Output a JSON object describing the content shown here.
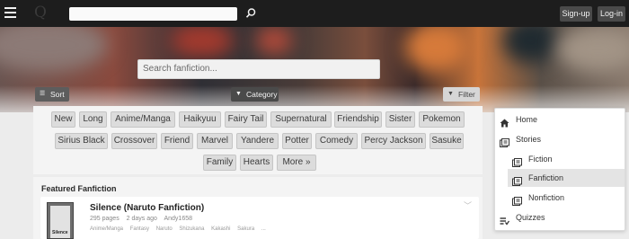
{
  "topbar": {
    "logo": "Q",
    "search_placeholder": "",
    "signup_label": "Sign-up",
    "login_label": "Log-in"
  },
  "hero": {
    "search_placeholder": "Search fanfiction...",
    "sort_label": "Sort",
    "category_label": "Category",
    "filter_label": "Filter"
  },
  "tags": [
    "New",
    "Long",
    "Anime/Manga",
    "Haikyuu",
    "Fairy Tail",
    "Supernatural",
    "Friendship",
    "Sister",
    "Pokemon",
    "Sirius Black",
    "Crossover",
    "Friend",
    "Marvel",
    "Yandere",
    "Potter",
    "Comedy",
    "Percy Jackson",
    "Sasuke",
    "Family",
    "Hearts",
    "More »"
  ],
  "featured": {
    "heading": "Featured Fanfiction",
    "story": {
      "title": "Silence (Naruto Fanfiction)",
      "pages": "295 pages",
      "time": "2 days ago",
      "author": "Andy1658",
      "tags": [
        "Anime/Manga",
        "Fantasy",
        "Naruto",
        "Shizukana",
        "Kakashi",
        "Sakura",
        "..."
      ],
      "thumb_text": "Silence"
    }
  },
  "menu": {
    "items": [
      {
        "label": "Home",
        "icon": "home-icon"
      },
      {
        "label": "Stories",
        "icon": "book-icon"
      },
      {
        "label": "Fiction",
        "icon": "book-icon"
      },
      {
        "label": "Fanfiction",
        "icon": "book-icon"
      },
      {
        "label": "Nonfiction",
        "icon": "book-icon"
      },
      {
        "label": "Quizzes",
        "icon": "list-icon"
      }
    ]
  },
  "colors": {
    "topbar": "#1d1d1d",
    "button_dark": "#4a4a4a",
    "tag_bg": "#dcdcdc",
    "menu_active": "#e4e4e4"
  }
}
